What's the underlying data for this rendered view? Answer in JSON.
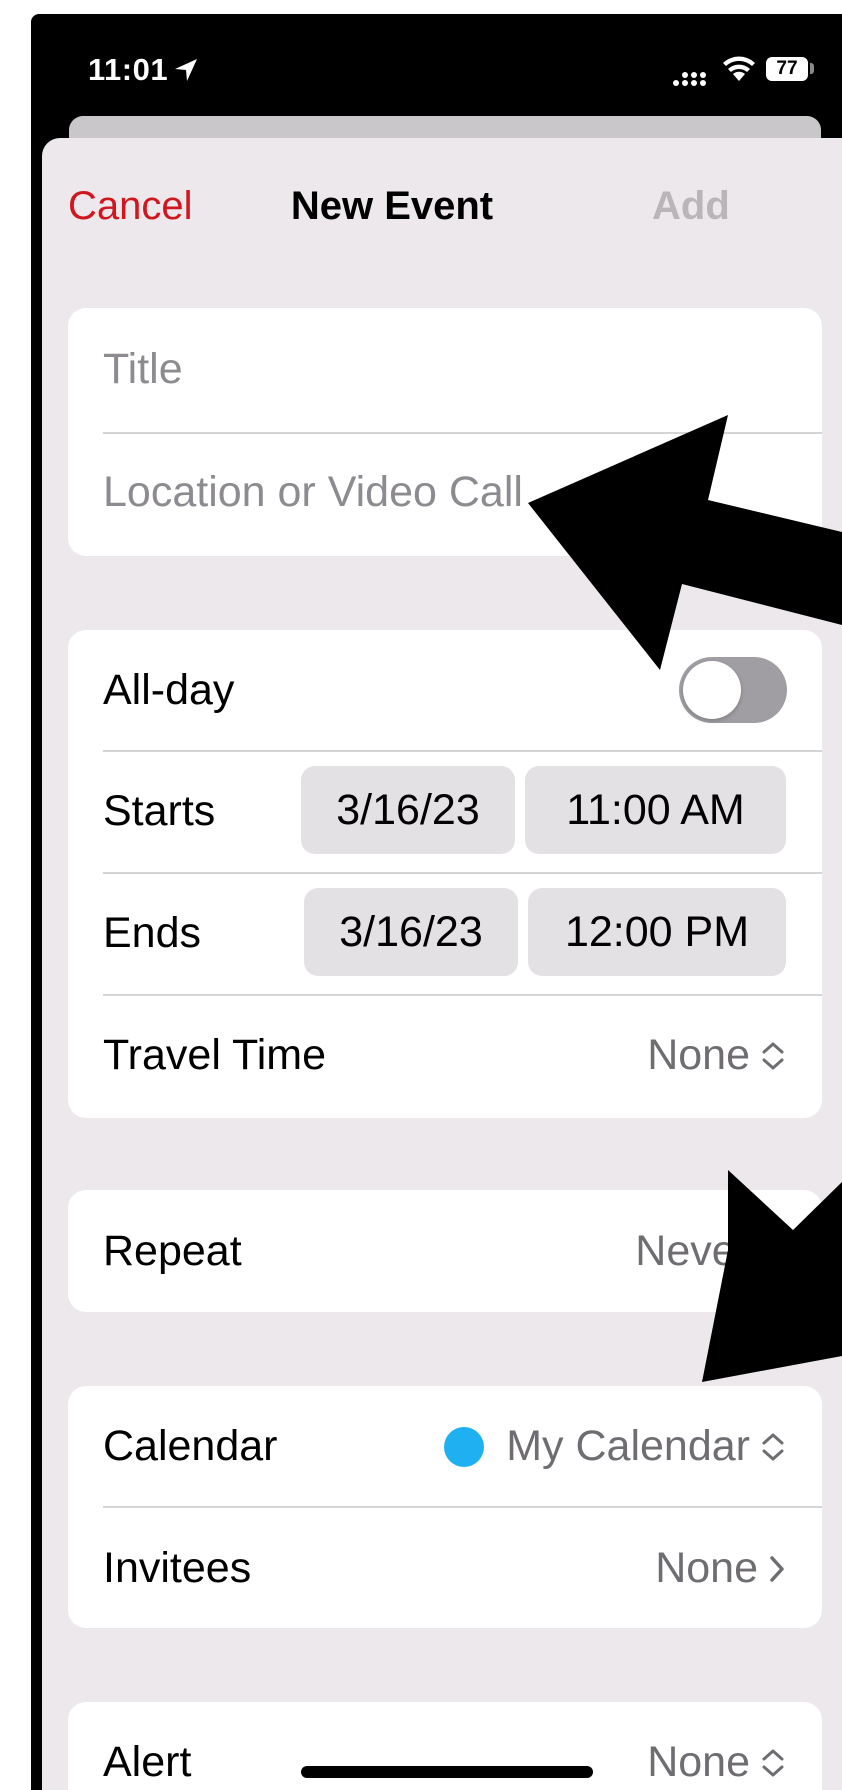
{
  "status_bar": {
    "time": "11:01",
    "battery": "77"
  },
  "nav": {
    "cancel": "Cancel",
    "title": "New Event",
    "add": "Add"
  },
  "details": {
    "title_placeholder": "Title",
    "location_placeholder": "Location or Video Call"
  },
  "timing": {
    "all_day_label": "All-day",
    "all_day_on": false,
    "starts_label": "Starts",
    "starts_date": "3/16/23",
    "starts_time": "11:00 AM",
    "ends_label": "Ends",
    "ends_date": "3/16/23",
    "ends_time": "12:00 PM",
    "travel_label": "Travel Time",
    "travel_value": "None"
  },
  "repeat": {
    "label": "Repeat",
    "value": "Never"
  },
  "calendar": {
    "label": "Calendar",
    "value": "My Calendar",
    "color": "#1fb0f1",
    "invitees_label": "Invitees",
    "invitees_value": "None"
  },
  "alert": {
    "label": "Alert",
    "value": "None"
  },
  "colors": {
    "accent_red": "#d0161f",
    "sheet_bg": "#ece8eb"
  }
}
